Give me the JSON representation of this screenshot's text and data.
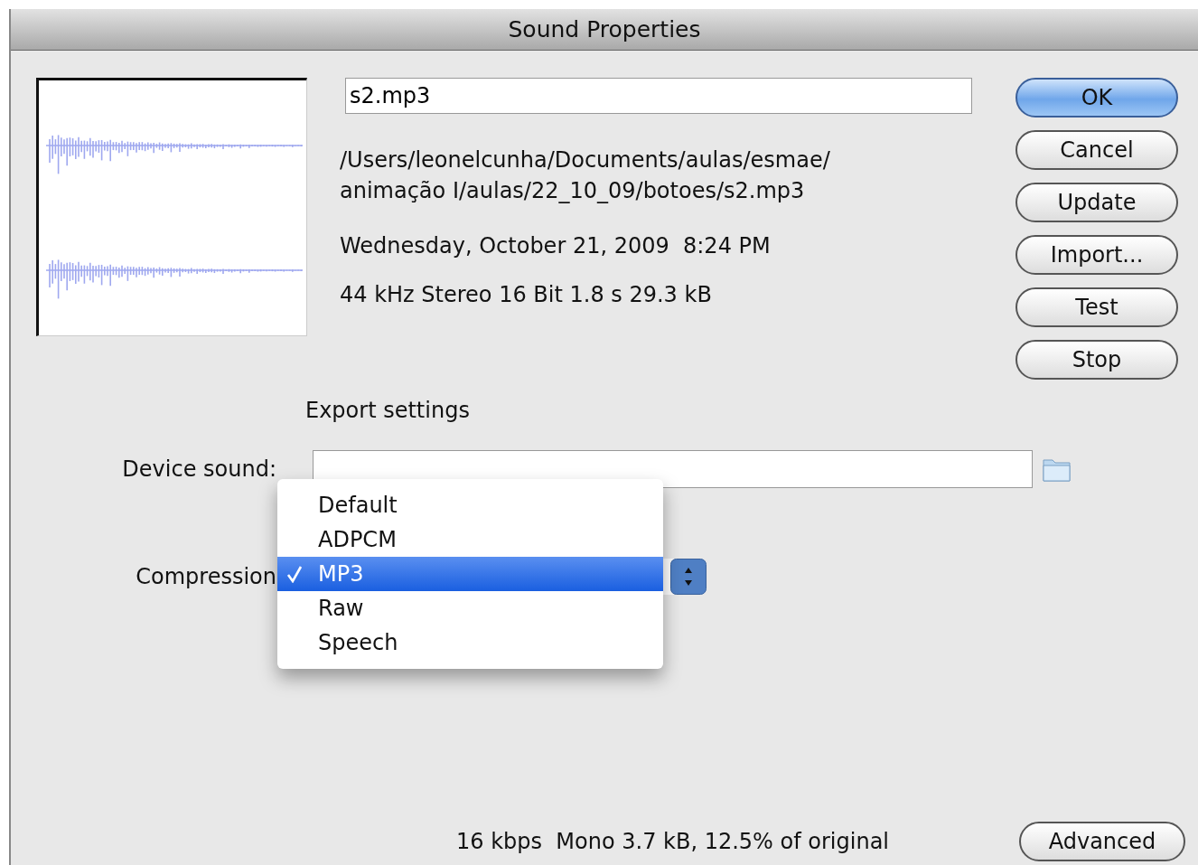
{
  "window": {
    "title": "Sound Properties"
  },
  "sound": {
    "name": "s2.mp3",
    "path_lines": [
      "/Users/leonelcunha/Documents/aulas/esmae/",
      "animação I/aulas/22_10_09/botoes/s2.mp3"
    ],
    "date": "Wednesday, October 21, 2009  8:24 PM",
    "format": "44 kHz Stereo 16 Bit 1.8 s 29.3 kB"
  },
  "buttons": [
    {
      "label": "OK",
      "default": true
    },
    {
      "label": "Cancel",
      "default": false
    },
    {
      "label": "Update",
      "default": false
    },
    {
      "label": "Import...",
      "default": false
    },
    {
      "label": "Test",
      "default": false
    },
    {
      "label": "Stop",
      "default": false
    }
  ],
  "export": {
    "heading": "Export settings",
    "device_sound_label": "Device sound:",
    "compression": {
      "label": "Compression",
      "expanded": true,
      "options": [
        {
          "label": "Default",
          "selected": false
        },
        {
          "label": "ADPCM",
          "selected": false
        },
        {
          "label": "MP3",
          "selected": true
        },
        {
          "label": "Raw",
          "selected": false
        },
        {
          "label": "Speech",
          "selected": false
        }
      ]
    },
    "summary": "16 kbps  Mono 3.7 kB, 12.5% of original",
    "advanced_button": "Advanced"
  }
}
